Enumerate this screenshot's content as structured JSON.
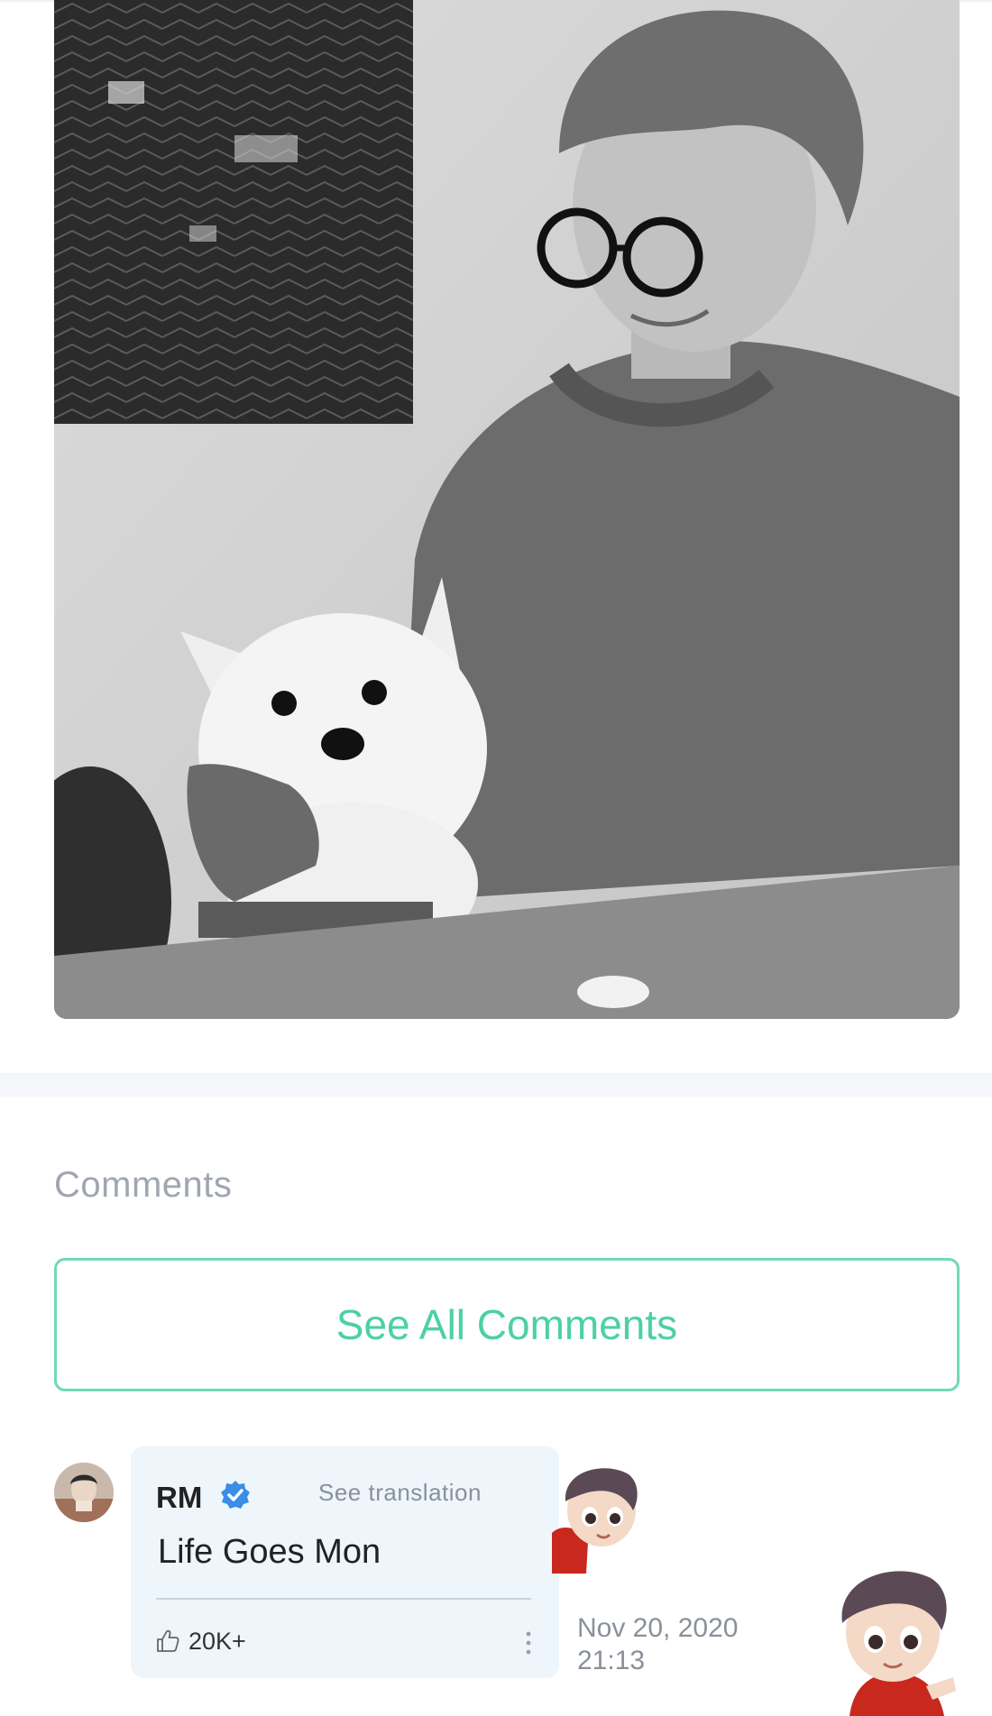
{
  "post": {
    "photo": {
      "icon": "photo-person-with-dog"
    }
  },
  "comments": {
    "heading": "Comments",
    "see_all_label": "See All Comments",
    "items": [
      {
        "author": "RM",
        "verified": true,
        "translate_label": "See translation",
        "text": "Life Goes Mon",
        "likes": "20K+",
        "date": "Nov 20, 2020",
        "time": "21:13"
      }
    ]
  },
  "colors": {
    "accent": "#4dd0a6",
    "bubble_bg": "#eef6fc",
    "verified": "#3a8ee6",
    "muted_text": "#a0a6b0"
  }
}
